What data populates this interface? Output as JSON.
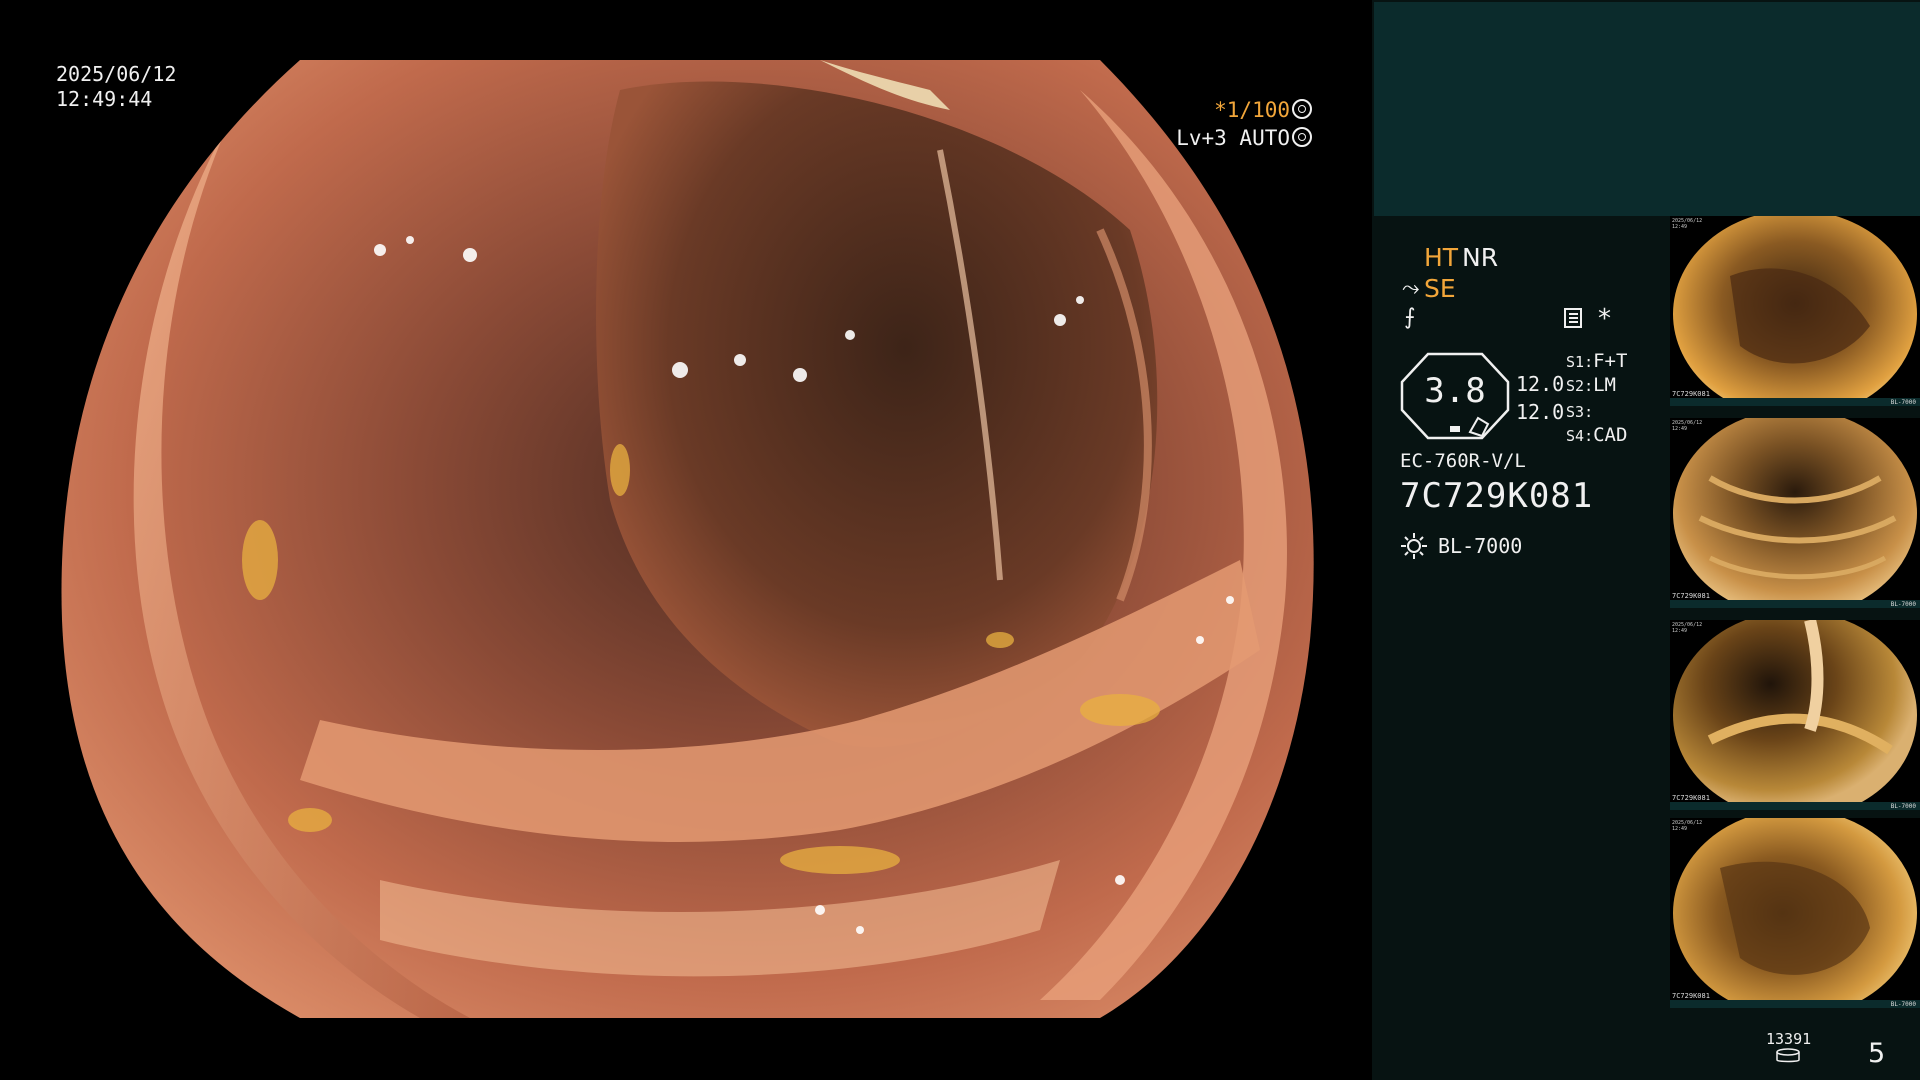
{
  "overlay": {
    "date": "2025/06/12",
    "time": "12:49:44",
    "shutter_prefix": "*1/100",
    "level": "Lv+3",
    "exposure_mode": "AUTO",
    "icons": [
      "shutter-gear-icon",
      "auto-gear-icon"
    ]
  },
  "panel": {
    "ht_label": "HT",
    "nr_label": "NR",
    "se_label": "SE",
    "star_label": "*",
    "main_value": "3.8",
    "value_a": "12.0",
    "value_b": "12.0",
    "s_settings": [
      {
        "key": "S1",
        "value": "F+T"
      },
      {
        "key": "S2",
        "value": "LM"
      },
      {
        "key": "S3",
        "value": ""
      },
      {
        "key": "S4",
        "value": "CAD"
      }
    ],
    "scope_model": "EC-760R-V/L",
    "scope_serial": "7C729K081",
    "light_source": "BL-7000",
    "thumbnails": [
      {
        "caption": "7C729K081",
        "caption2": "BL-7000"
      },
      {
        "caption": "7C729K081",
        "caption2": "BL-7000"
      },
      {
        "caption": "7C729K081",
        "caption2": "BL-7000"
      },
      {
        "caption": "7C729K081",
        "caption2": "BL-7000"
      }
    ],
    "image_count": "13391",
    "page_number": "5"
  },
  "colors": {
    "accent": "#f2a63a",
    "panel_bg": "#071312",
    "panel_header": "#0b2b2c"
  }
}
